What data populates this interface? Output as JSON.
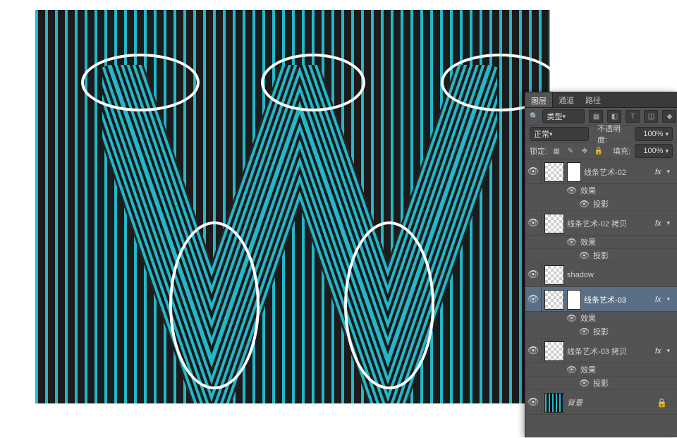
{
  "panel": {
    "tabs": {
      "layers": "图层",
      "channels": "通道",
      "paths": "路径"
    },
    "filter": {
      "label": "类型",
      "icons": [
        "▦",
        "◧",
        "T",
        "◫",
        "◆"
      ]
    },
    "blend": {
      "mode": "正常",
      "opacity_label": "不透明度:",
      "opacity_value": "100%"
    },
    "lock": {
      "label": "锁定:",
      "fill_label": "填充:",
      "fill_value": "100%"
    }
  },
  "layers": [
    {
      "visible": true,
      "fx": true,
      "selected": false,
      "thumb": "trans",
      "mask": true,
      "name": "线条艺术-02",
      "effects": {
        "label": "效果",
        "items": [
          {
            "visible": true,
            "name": "投影"
          }
        ]
      }
    },
    {
      "visible": true,
      "fx": true,
      "selected": false,
      "thumb": "trans",
      "mask": false,
      "name": "线条艺术-02 拷贝",
      "effects": {
        "label": "效果",
        "items": [
          {
            "visible": true,
            "name": "投影"
          }
        ]
      }
    },
    {
      "visible": true,
      "fx": false,
      "selected": false,
      "thumb": "trans",
      "mask": false,
      "name": "shadow"
    },
    {
      "visible": true,
      "fx": true,
      "selected": true,
      "thumb": "trans",
      "mask": true,
      "name": "线条艺术-03",
      "effects": {
        "label": "效果",
        "items": [
          {
            "visible": true,
            "name": "投影"
          }
        ]
      }
    },
    {
      "visible": true,
      "fx": true,
      "selected": false,
      "thumb": "trans",
      "mask": false,
      "name": "线条艺术-03 拷贝",
      "effects": {
        "label": "效果",
        "items": [
          {
            "visible": true,
            "name": "投影"
          }
        ]
      }
    },
    {
      "visible": true,
      "fx": false,
      "selected": false,
      "locked": true,
      "thumb": "stripe",
      "mask": false,
      "name": "背景",
      "italic": true
    }
  ]
}
